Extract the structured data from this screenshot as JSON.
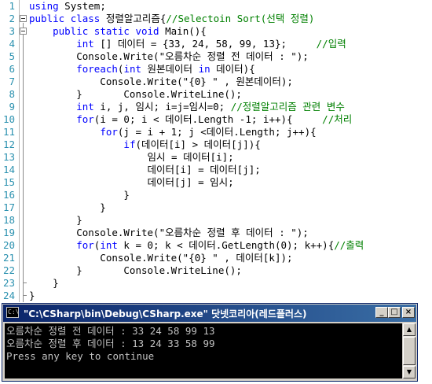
{
  "editor": {
    "lines": [
      {
        "n": "1",
        "parts": [
          {
            "c": "kw",
            "t": "using"
          },
          {
            "c": "tx",
            "t": " System;"
          }
        ]
      },
      {
        "n": "2",
        "parts": [
          {
            "c": "kw",
            "t": "public"
          },
          {
            "c": "tx",
            "t": " "
          },
          {
            "c": "kw",
            "t": "class"
          },
          {
            "c": "tx",
            "t": " 정렬알고리즘{"
          },
          {
            "c": "cm",
            "t": "//Selectoin Sort(선택 정렬)"
          }
        ]
      },
      {
        "n": "3",
        "parts": [
          {
            "c": "tx",
            "t": "    "
          },
          {
            "c": "kw",
            "t": "public"
          },
          {
            "c": "tx",
            "t": " "
          },
          {
            "c": "kw",
            "t": "static"
          },
          {
            "c": "tx",
            "t": " "
          },
          {
            "c": "kw",
            "t": "void"
          },
          {
            "c": "tx",
            "t": " Main(){"
          }
        ]
      },
      {
        "n": "4",
        "parts": [
          {
            "c": "tx",
            "t": "        "
          },
          {
            "c": "kw",
            "t": "int"
          },
          {
            "c": "tx",
            "t": " [] 데이터 = {33, 24, 58, 99, 13};     "
          },
          {
            "c": "cm",
            "t": "//입력"
          }
        ]
      },
      {
        "n": "5",
        "parts": [
          {
            "c": "tx",
            "t": "        Console.Write(\"오름차순 정렬 전 데이터 : \");"
          }
        ]
      },
      {
        "n": "6",
        "parts": [
          {
            "c": "tx",
            "t": "        "
          },
          {
            "c": "kw",
            "t": "foreach"
          },
          {
            "c": "tx",
            "t": "("
          },
          {
            "c": "kw",
            "t": "int"
          },
          {
            "c": "tx",
            "t": " 원본데이터 "
          },
          {
            "c": "kw",
            "t": "in"
          },
          {
            "c": "tx",
            "t": " 데이터){"
          }
        ]
      },
      {
        "n": "7",
        "parts": [
          {
            "c": "tx",
            "t": "            Console.Write(\"{0} \" , 원본데이터);"
          }
        ]
      },
      {
        "n": "8",
        "parts": [
          {
            "c": "tx",
            "t": "        }       Console.WriteLine();"
          }
        ]
      },
      {
        "n": "9",
        "parts": [
          {
            "c": "tx",
            "t": "        "
          },
          {
            "c": "kw",
            "t": "int"
          },
          {
            "c": "tx",
            "t": " i, j, 임시; i=j=임시=0; "
          },
          {
            "c": "cm",
            "t": "//정렬알고리즘 관련 변수"
          }
        ]
      },
      {
        "n": "10",
        "parts": [
          {
            "c": "tx",
            "t": "        "
          },
          {
            "c": "kw",
            "t": "for"
          },
          {
            "c": "tx",
            "t": "(i = 0; i < 데이터.Length -1; i++){     "
          },
          {
            "c": "cm",
            "t": "//처리"
          }
        ]
      },
      {
        "n": "11",
        "parts": [
          {
            "c": "tx",
            "t": "            "
          },
          {
            "c": "kw",
            "t": "for"
          },
          {
            "c": "tx",
            "t": "(j = i + 1; j <데이터.Length; j++){"
          }
        ]
      },
      {
        "n": "12",
        "parts": [
          {
            "c": "tx",
            "t": "                "
          },
          {
            "c": "kw",
            "t": "if"
          },
          {
            "c": "tx",
            "t": "(데이터[i] > 데이터[j]){"
          }
        ]
      },
      {
        "n": "13",
        "parts": [
          {
            "c": "tx",
            "t": "                    임시 = 데이터[i];"
          }
        ]
      },
      {
        "n": "14",
        "parts": [
          {
            "c": "tx",
            "t": "                    데이터[i] = 데이터[j];"
          }
        ]
      },
      {
        "n": "15",
        "parts": [
          {
            "c": "tx",
            "t": "                    데이터[j] = 임시;"
          }
        ]
      },
      {
        "n": "16",
        "parts": [
          {
            "c": "tx",
            "t": "                }"
          }
        ]
      },
      {
        "n": "17",
        "parts": [
          {
            "c": "tx",
            "t": "            }"
          }
        ]
      },
      {
        "n": "18",
        "parts": [
          {
            "c": "tx",
            "t": "        }"
          }
        ]
      },
      {
        "n": "19",
        "parts": [
          {
            "c": "tx",
            "t": "        Console.Write(\"오름차순 정렬 후 데이터 : \");"
          }
        ]
      },
      {
        "n": "20",
        "parts": [
          {
            "c": "tx",
            "t": "        "
          },
          {
            "c": "kw",
            "t": "for"
          },
          {
            "c": "tx",
            "t": "("
          },
          {
            "c": "kw",
            "t": "int"
          },
          {
            "c": "tx",
            "t": " k = 0; k < 데이터.GetLength(0); k++){"
          },
          {
            "c": "cm",
            "t": "//출력"
          }
        ]
      },
      {
        "n": "21",
        "parts": [
          {
            "c": "tx",
            "t": "            Console.Write(\"{0} \" , 데이터[k]);"
          }
        ]
      },
      {
        "n": "22",
        "parts": [
          {
            "c": "tx",
            "t": "        }       Console.WriteLine();"
          }
        ]
      },
      {
        "n": "23",
        "parts": [
          {
            "c": "tx",
            "t": "    }"
          }
        ]
      },
      {
        "n": "24",
        "parts": [
          {
            "c": "tx",
            "t": "}"
          }
        ]
      }
    ]
  },
  "console": {
    "title": "\"C:\\CSharp\\bin\\Debug\\CSharp.exe\" 닷넷코리아(레드플러스)",
    "icon_label": "C:\\",
    "buttons": {
      "minimize": "_",
      "maximize": "□",
      "close": "×"
    },
    "scroll": {
      "up": "▲",
      "down": "▼"
    },
    "output": [
      "오름차순 정렬 전 데이터 : 33 24 58 99 13",
      "오름차순 정렬 후 데이터 : 13 24 33 58 99",
      "Press any key to continue"
    ]
  }
}
